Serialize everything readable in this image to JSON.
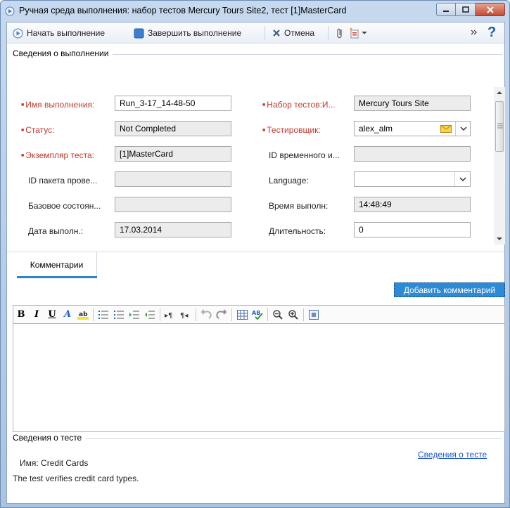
{
  "window": {
    "title": "Ручная среда выполнения: набор тестов Mercury Tours Site2, тест [1]MasterCard"
  },
  "toolbar": {
    "start_label": "Начать выполнение",
    "finish_label": "Завершить выполнение",
    "cancel_label": "Отмена"
  },
  "run_details": {
    "caption": "Сведения о выполнении",
    "fields": {
      "run_name": {
        "label": "Имя выполнения:",
        "value": "Run_3-17_14-48-50"
      },
      "test_set": {
        "label": "Набор тестов:И...",
        "value": "Mercury Tours Site"
      },
      "status": {
        "label": "Статус:",
        "value": "Not Completed"
      },
      "tester": {
        "label": "Тестировщик:",
        "value": "alex_alm"
      },
      "test_instance": {
        "label": "Экземпляр теста:",
        "value": "[1]MasterCard"
      },
      "temp_id": {
        "label": "ID временного и...",
        "value": ""
      },
      "test_package": {
        "label": "ID пакета прове...",
        "value": ""
      },
      "language": {
        "label": "Language:",
        "value": ""
      },
      "base_state": {
        "label": "Базовое состоян...",
        "value": ""
      },
      "exec_time": {
        "label": "Время выполн:",
        "value": "14:48:49"
      },
      "exec_date": {
        "label": "Дата выполн.:",
        "value": "17.03.2014"
      },
      "duration": {
        "label": "Длительность:",
        "value": "0"
      }
    }
  },
  "comments": {
    "tab_label": "Комментарии",
    "add_button": "Добавить комментарий"
  },
  "test_details": {
    "caption": "Сведения о тесте",
    "link": "Сведения о тесте",
    "name_line": "Имя: Credit Cards",
    "description": "The test verifies credit card types."
  },
  "colors": {
    "required_label": "#c0392b",
    "accent": "#2f8ad6",
    "link": "#1a56c7"
  }
}
